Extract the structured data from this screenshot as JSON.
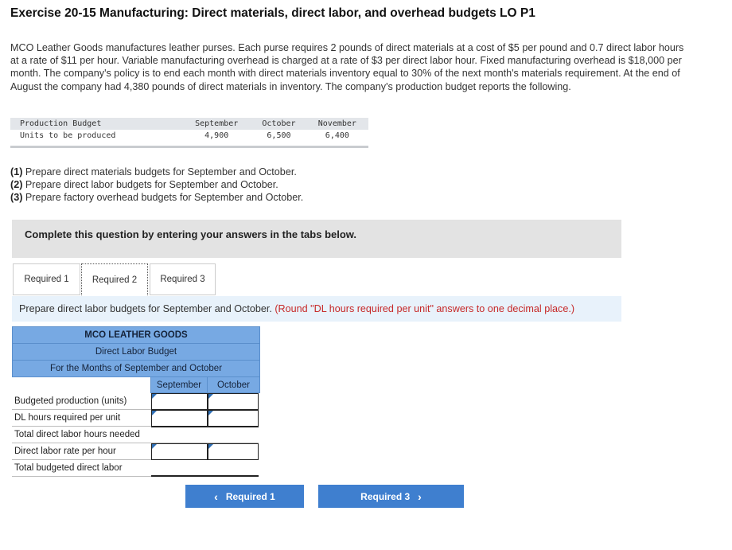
{
  "title": "Exercise 20-15 Manufacturing: Direct materials, direct labor, and overhead budgets LO P1",
  "intro": "MCO Leather Goods manufactures leather purses. Each purse requires 2 pounds of direct materials at a cost of $5 per pound and 0.7 direct labor hours at a rate of $11 per hour. Variable manufacturing overhead is charged at a rate of $3 per direct labor hour. Fixed manufacturing overhead is $18,000 per month. The company's policy is to end each month with direct materials inventory equal to 30% of the next month's materials requirement. At the end of August the company had 4,380 pounds of direct materials in inventory. The company's production budget reports the following.",
  "production_budget": {
    "header": [
      "Production Budget",
      "September",
      "October",
      "November"
    ],
    "row": [
      "Units to be produced",
      "4,900",
      "6,500",
      "6,400"
    ]
  },
  "requirements": [
    {
      "num": "(1)",
      "text": " Prepare direct materials budgets for September and October."
    },
    {
      "num": "(2)",
      "text": " Prepare direct labor budgets for September and October."
    },
    {
      "num": "(3)",
      "text": " Prepare factory overhead budgets for September and October."
    }
  ],
  "banner": "Complete this question by entering your answers in the tabs below.",
  "tabs": [
    "Required 1",
    "Required 2",
    "Required 3"
  ],
  "active_tab": "Required 2",
  "instruction": {
    "text": "Prepare direct labor budgets for September and October.",
    "note": "(Round \"DL hours required per unit\" answers to one decimal place.)"
  },
  "budget": {
    "company": "MCO LEATHER GOODS",
    "name": "Direct Labor Budget",
    "period": "For the Months of September and October",
    "columns": [
      "September",
      "October"
    ],
    "rows": [
      {
        "label": "Budgeted production (units)"
      },
      {
        "label": "DL hours required per unit"
      },
      {
        "label": "Total direct labor hours needed"
      },
      {
        "label": "Direct labor rate per hour"
      },
      {
        "label": "Total budgeted direct labor"
      }
    ]
  },
  "nav": {
    "prev_label": "Required 1",
    "next_label": "Required 3",
    "prev_icon": "chevron-left-icon",
    "next_icon": "chevron-right-icon"
  },
  "colors": {
    "accent": "#3f7fcf",
    "table_header": "#77a9e3",
    "note_red": "#c62828"
  }
}
